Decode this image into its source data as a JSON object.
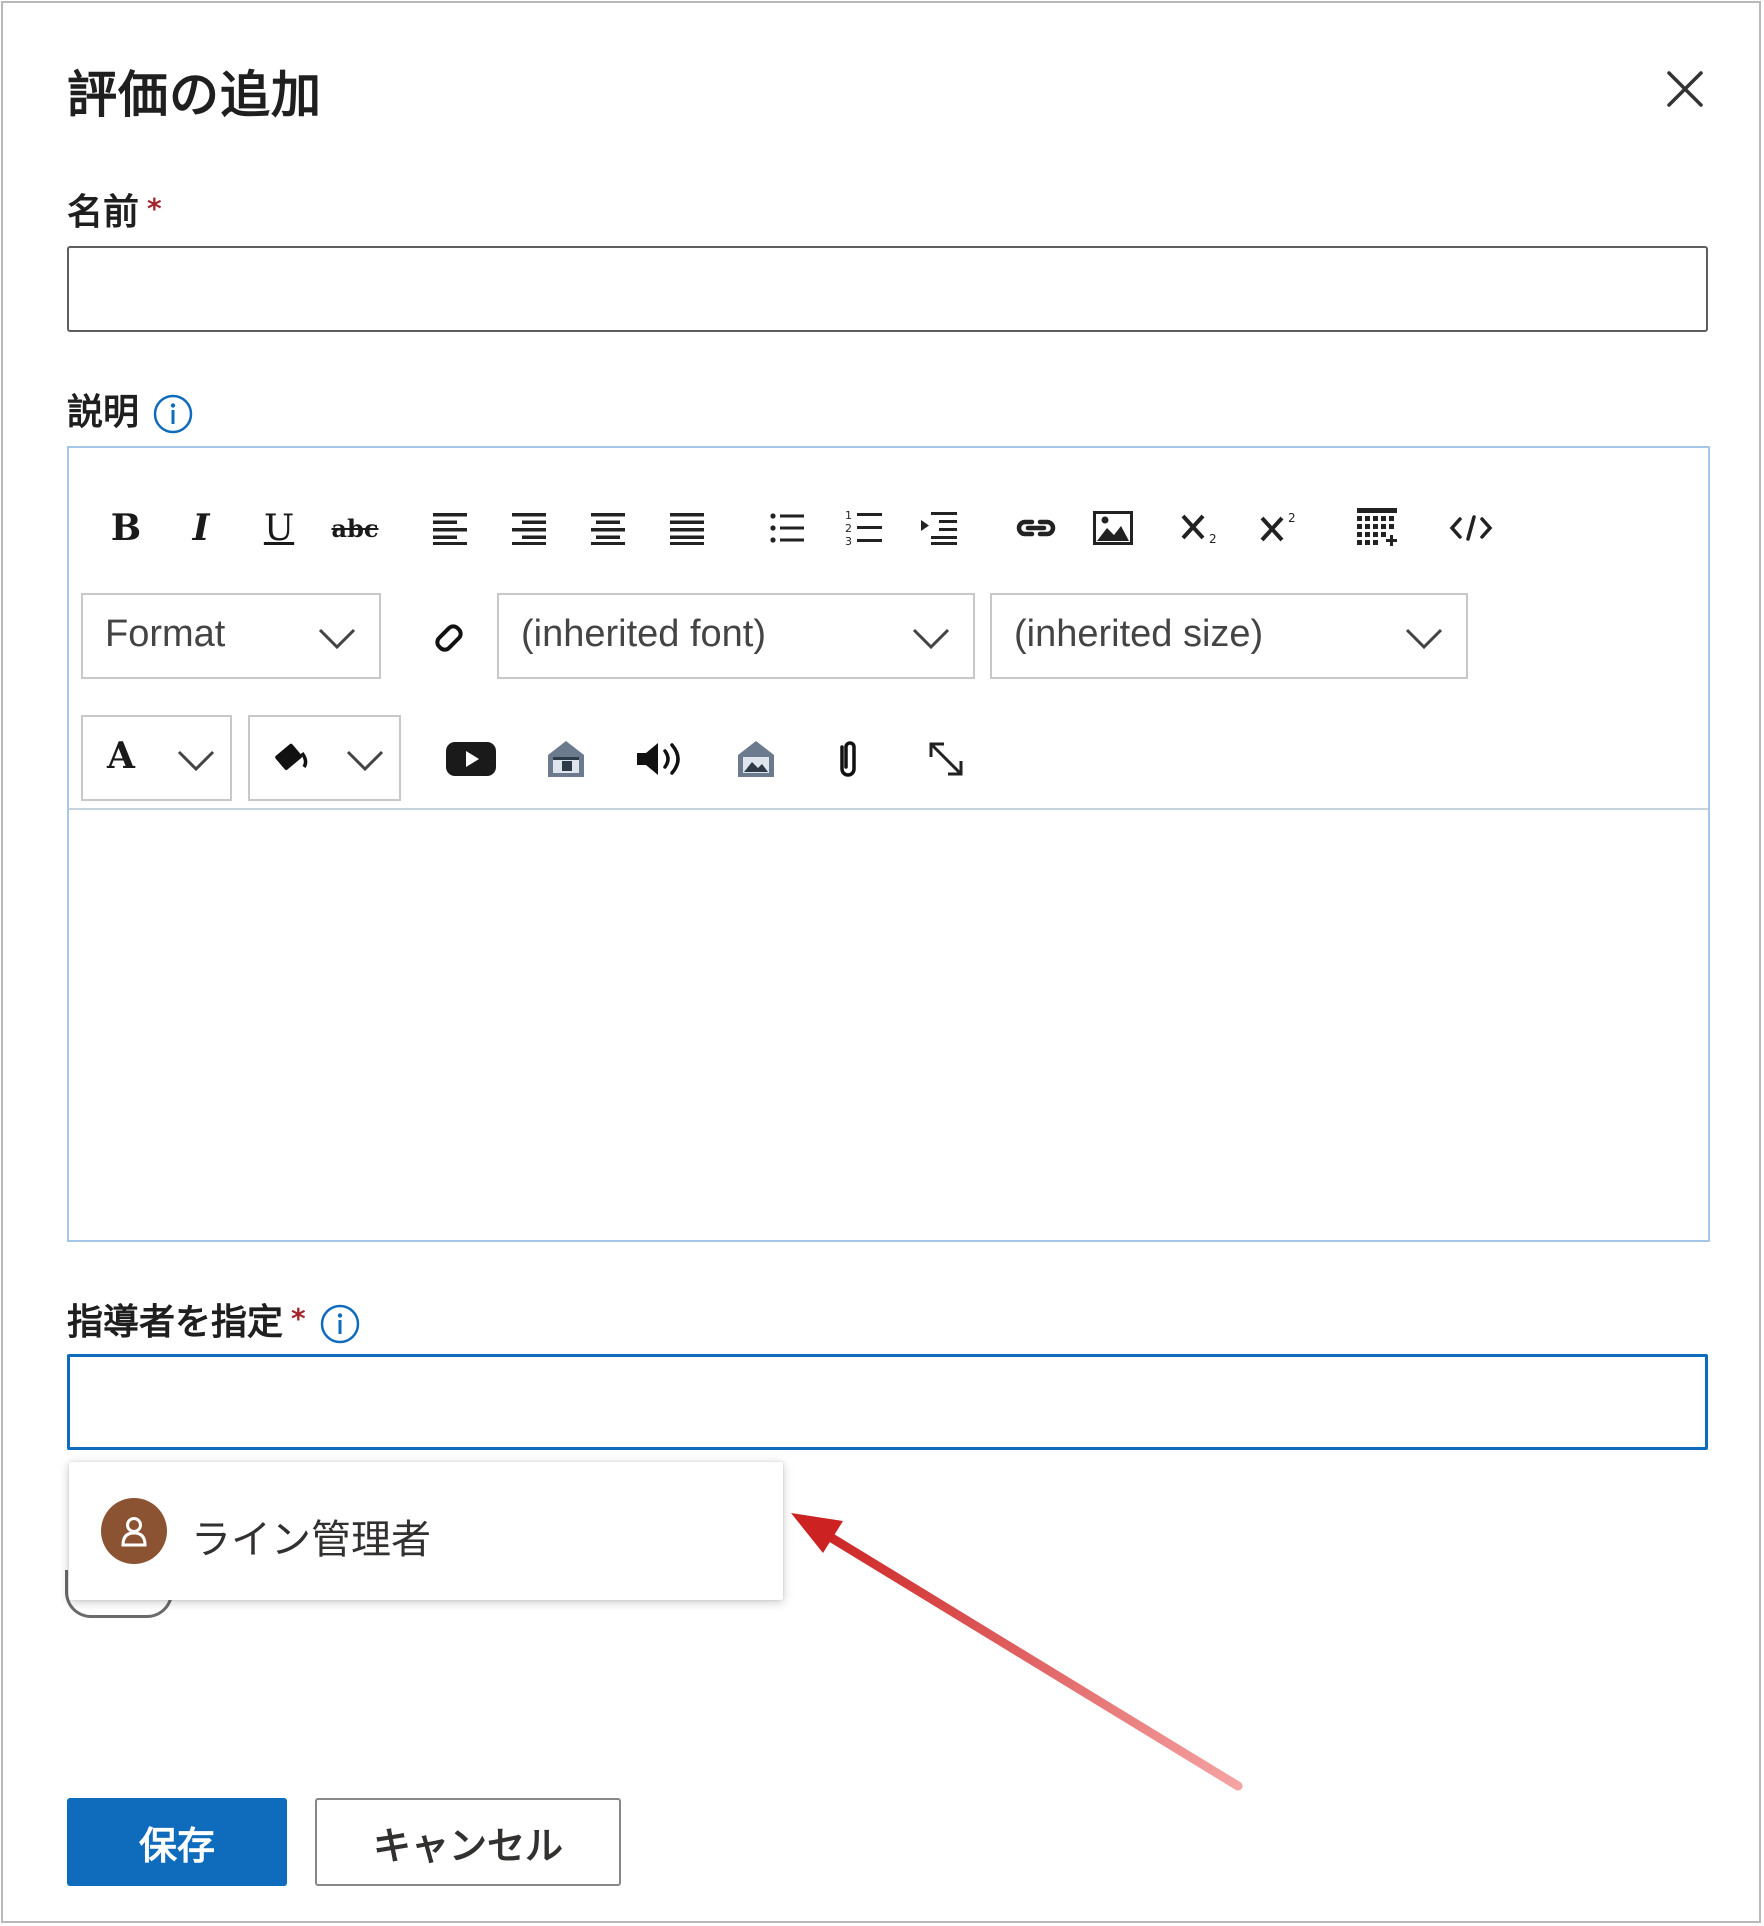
{
  "dialog": {
    "title": "評価の追加",
    "close_icon": "close-icon"
  },
  "fields": {
    "name": {
      "label": "名前",
      "required_mark": "*",
      "value": ""
    },
    "description": {
      "label": "説明",
      "info_icon": "info-icon"
    },
    "instructor": {
      "label": "指導者を指定",
      "required_mark": "*",
      "info_icon": "info-icon",
      "value": ""
    }
  },
  "editor": {
    "toolbar_row1": [
      "bold",
      "italic",
      "underline",
      "strikethrough",
      "align-left",
      "align-right",
      "align-center",
      "align-justify",
      "bulleted-list",
      "numbered-list",
      "indent",
      "link",
      "image",
      "subscript",
      "superscript",
      "table",
      "html-source"
    ],
    "format_dropdown": "Format",
    "font_dropdown": "(inherited font)",
    "size_dropdown": "(inherited size)",
    "toolbar_row3": [
      "font-color",
      "highlight-color",
      "youtube",
      "video",
      "audio",
      "insert-picture",
      "attachment",
      "expand"
    ],
    "bold_glyph": "B",
    "italic_glyph": "I",
    "underline_glyph": "U",
    "strike_glyph": "abc",
    "font_color_glyph": "A",
    "content": ""
  },
  "suggestion": {
    "name": "ライン管理者",
    "avatar_color": "#8c5332"
  },
  "actions": {
    "save": "保存",
    "cancel": "キャンセル"
  },
  "colors": {
    "primary": "#0f6cbd",
    "required": "#a4262c",
    "annotation_arrow": "#d32f2f"
  }
}
